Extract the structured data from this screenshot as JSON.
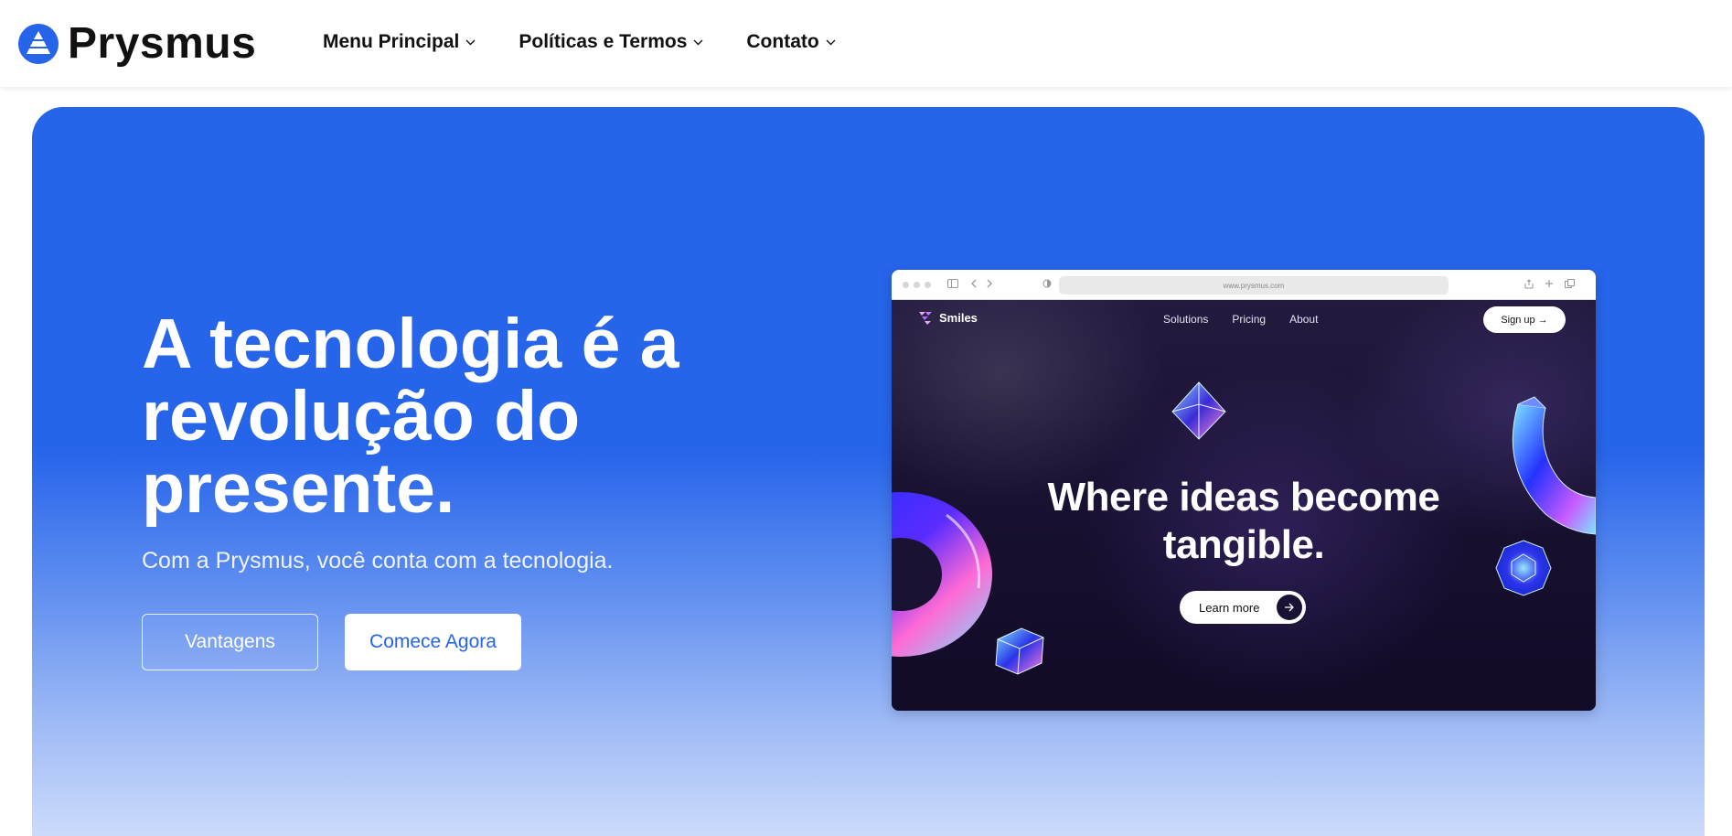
{
  "header": {
    "brand": "Prysmus",
    "nav": [
      {
        "label": "Menu Principal"
      },
      {
        "label": "Políticas e Termos"
      },
      {
        "label": "Contato"
      }
    ]
  },
  "hero": {
    "title": "A tecnologia é a revolução do presente.",
    "subtitle": "Com a Prysmus, você conta com a tecnologia.",
    "primary_button": "Vantagens",
    "secondary_button": "Comece Agora"
  },
  "mockup": {
    "url": "www.prysmus.com",
    "brand": "Smiles",
    "nav": [
      "Solutions",
      "Pricing",
      "About"
    ],
    "signup": "Sign up →",
    "headline": "Where ideas become tangible.",
    "cta": "Learn more"
  },
  "colors": {
    "brand_blue": "#2664ea",
    "mockup_dark": "#1a1233"
  }
}
